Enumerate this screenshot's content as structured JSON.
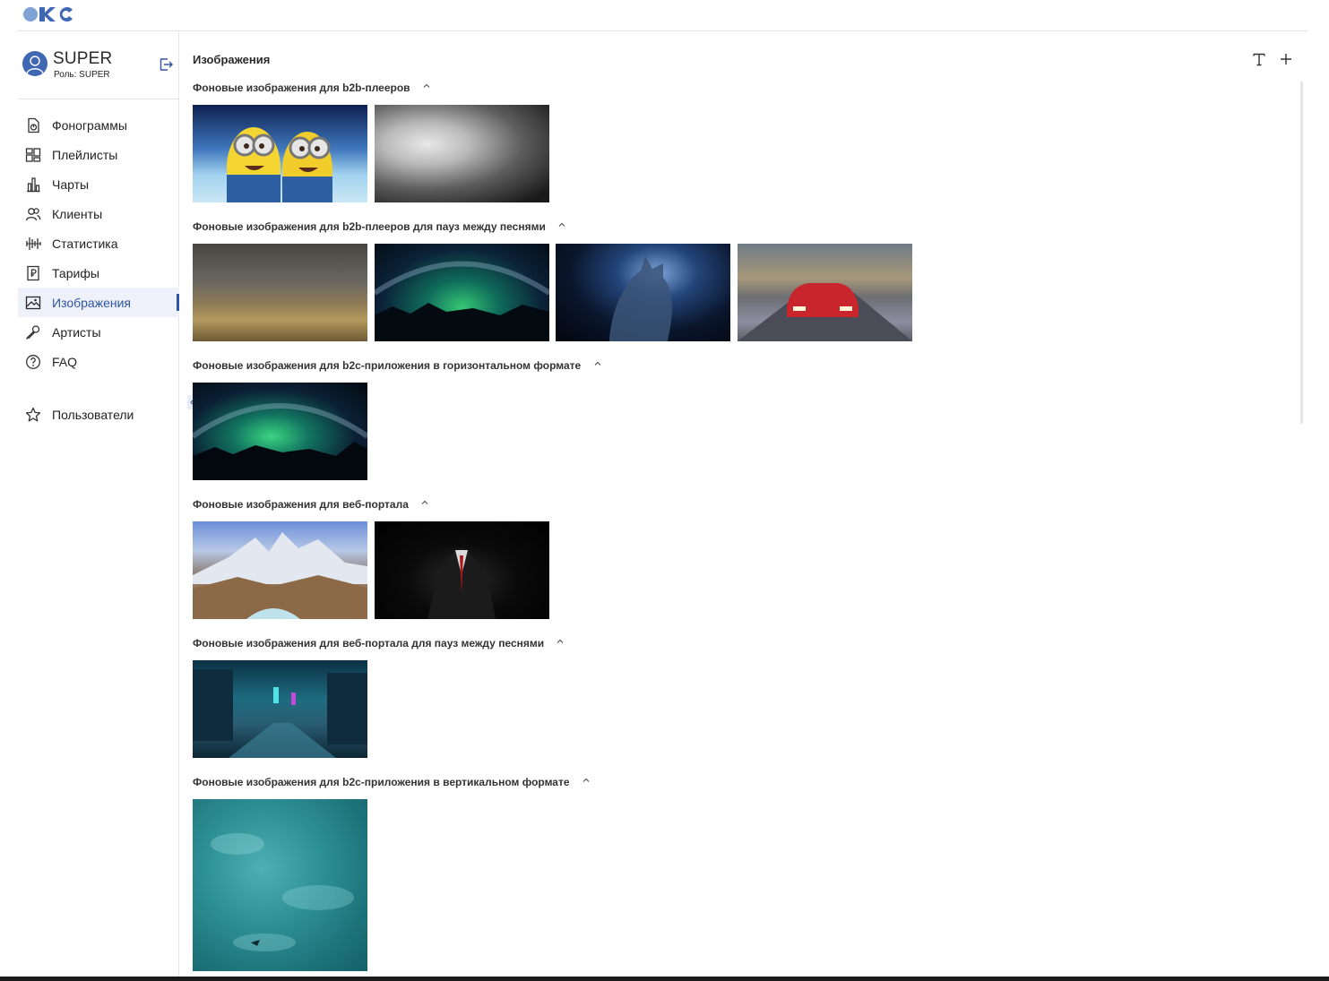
{
  "sidebar": {
    "user": {
      "name": "SUPER",
      "role": "Роль: SUPER"
    },
    "items": [
      {
        "label": "Фонограммы",
        "icon": "audio-file-icon"
      },
      {
        "label": "Плейлисты",
        "icon": "dashboard-grid-icon"
      },
      {
        "label": "Чарты",
        "icon": "bar-chart-icon"
      },
      {
        "label": "Клиенты",
        "icon": "users-icon"
      },
      {
        "label": "Статистика",
        "icon": "waveform-icon"
      },
      {
        "label": "Тарифы",
        "icon": "ruble-document-icon"
      },
      {
        "label": "Изображения",
        "icon": "image-icon",
        "active": true
      },
      {
        "label": "Артисты",
        "icon": "microphone-icon"
      },
      {
        "label": "FAQ",
        "icon": "question-circle-icon"
      }
    ],
    "admin_items": [
      {
        "label": "Пользователи",
        "icon": "star-icon"
      }
    ]
  },
  "main": {
    "title": "Изображения",
    "sections": [
      {
        "title": "Фоновые изображения для b2b-плееров",
        "images": [
          "minions",
          "clouds"
        ]
      },
      {
        "title": "Фоновые изображения для b2b-плееров для пауз между песнями",
        "images": [
          "storm-field",
          "aurora-lake",
          "cat",
          "red-car"
        ]
      },
      {
        "title": "Фоновые изображения для b2c-приложения в горизонтальном формате",
        "images": [
          "aurora-lake"
        ]
      },
      {
        "title": "Фоновые изображения для веб-портала",
        "images": [
          "mountains",
          "suit"
        ]
      },
      {
        "title": "Фоновые изображения для веб-портала для пауз между песнями",
        "images": [
          "neon-city"
        ]
      },
      {
        "title": "Фоновые изображения для b2c-приложения в вертикальном формате",
        "images": [
          "water"
        ]
      }
    ]
  },
  "colors": {
    "accent": "#2e55a5",
    "active_bg": "#eef1f9",
    "logo_light": "#7fa3d4",
    "logo_dark": "#3f67b4"
  }
}
